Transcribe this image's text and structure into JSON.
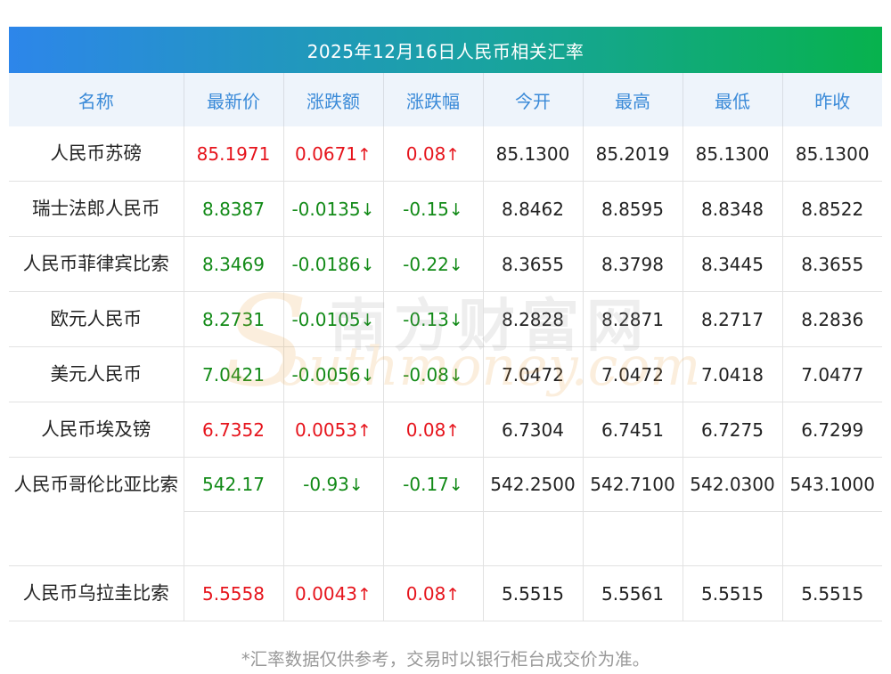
{
  "title": "2025年12月16日人民币相关汇率",
  "columns": [
    "名称",
    "最新价",
    "涨跌额",
    "涨跌幅",
    "今开",
    "最高",
    "最低",
    "昨收"
  ],
  "rows": [
    {
      "name": "人民币苏磅",
      "latest": "85.1971",
      "change": "0.0671",
      "change_pct": "0.08",
      "trend": "up",
      "open": "85.1300",
      "high": "85.2019",
      "low": "85.1300",
      "prev_close": "85.1300"
    },
    {
      "name": "瑞士法郎人民币",
      "latest": "8.8387",
      "change": "-0.0135",
      "change_pct": "-0.15",
      "trend": "down",
      "open": "8.8462",
      "high": "8.8595",
      "low": "8.8348",
      "prev_close": "8.8522"
    },
    {
      "name": "人民币菲律宾比索",
      "latest": "8.3469",
      "change": "-0.0186",
      "change_pct": "-0.22",
      "trend": "down",
      "open": "8.3655",
      "high": "8.3798",
      "low": "8.3445",
      "prev_close": "8.3655"
    },
    {
      "name": "欧元人民币",
      "latest": "8.2731",
      "change": "-0.0105",
      "change_pct": "-0.13",
      "trend": "down",
      "open": "8.2828",
      "high": "8.2871",
      "low": "8.2717",
      "prev_close": "8.2836"
    },
    {
      "name": "美元人民币",
      "latest": "7.0421",
      "change": "-0.0056",
      "change_pct": "-0.08",
      "trend": "down",
      "open": "7.0472",
      "high": "7.0472",
      "low": "7.0418",
      "prev_close": "7.0477"
    },
    {
      "name": "人民币埃及镑",
      "latest": "6.7352",
      "change": "0.0053",
      "change_pct": "0.08",
      "trend": "up",
      "open": "6.7304",
      "high": "6.7451",
      "low": "6.7275",
      "prev_close": "6.7299"
    },
    {
      "name": "人民币哥伦比亚比索",
      "latest": "542.17",
      "change": "-0.93",
      "change_pct": "-0.17",
      "trend": "down",
      "open": "542.2500",
      "high": "542.7100",
      "low": "542.0300",
      "prev_close": "543.1000"
    },
    {
      "name": "人民币乌拉圭比索",
      "latest": "5.5558",
      "change": "0.0043",
      "change_pct": "0.08",
      "trend": "up",
      "open": "5.5515",
      "high": "5.5561",
      "low": "5.5515",
      "prev_close": "5.5515"
    }
  ],
  "arrows": {
    "up": "↑",
    "down": "↓"
  },
  "footer": "*汇率数据仅供参考，交易时以银行柜台成交价为准。",
  "watermark": {
    "cn": "南方财富网",
    "en": "outhmoney.com",
    "s": "S"
  },
  "colors": {
    "up": "#e6141c",
    "down": "#128a17",
    "header_text": "#3a8ad8"
  }
}
